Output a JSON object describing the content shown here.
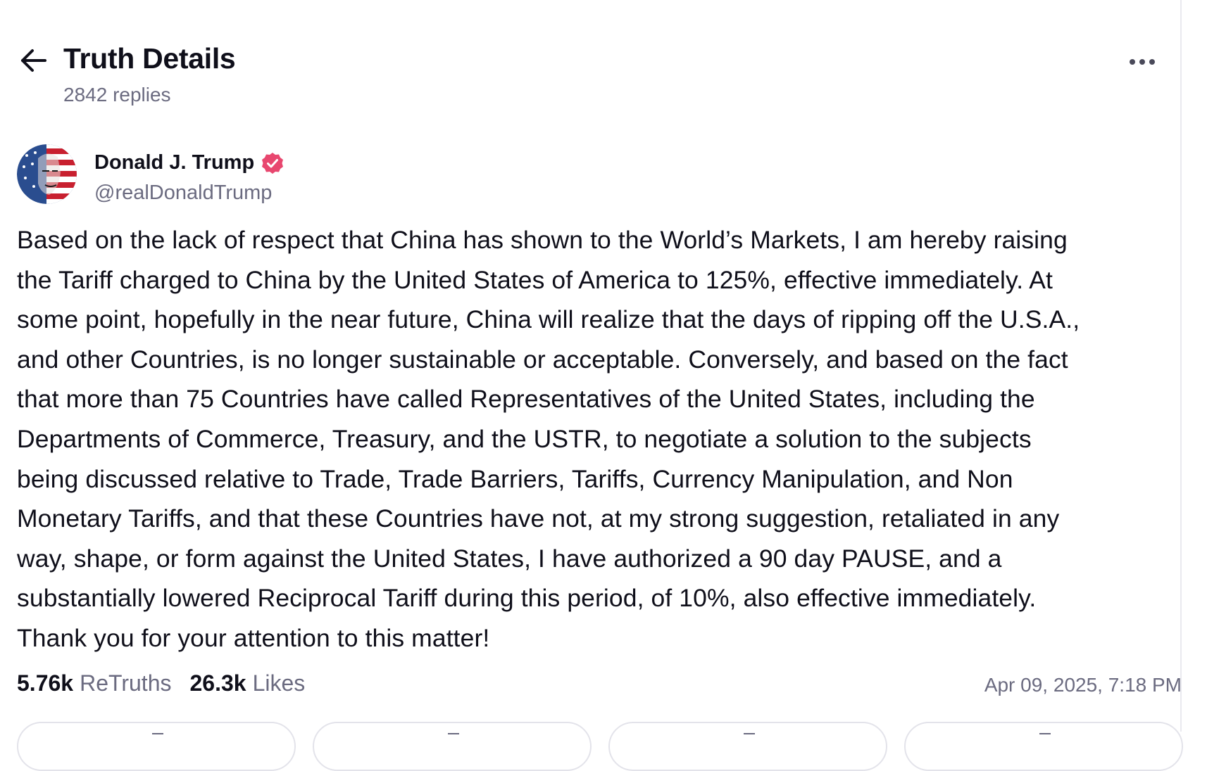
{
  "header": {
    "title": "Truth Details",
    "reply_count": "2842 replies",
    "back_icon": "arrow-left-icon",
    "more_icon": "more-horizontal-icon"
  },
  "post": {
    "author": {
      "name": "Donald J. Trump",
      "handle": "@realDonaldTrump",
      "verified": true,
      "avatar": "avatar-image"
    },
    "body_lines": [
      "Based on the lack of respect that China has shown to the World’s Markets, I am hereby raising",
      "the Tariff charged to China by the United States of America to 125%, effective immediately. At",
      "some point, hopefully in the near future, China will realize that the days of ripping off the U.S.A.,",
      "and other Countries, is no longer sustainable or acceptable. Conversely, and based on the fact",
      "that more than 75 Countries have called Representatives of the United States, including the",
      "Departments of Commerce, Treasury, and the USTR, to negotiate a solution to the subjects",
      "being discussed relative to Trade, Trade Barriers, Tariffs, Currency Manipulation, and Non",
      "Monetary Tariffs, and that these Countries have not, at my strong suggestion, retaliated in any",
      "way, shape, or form against the United States, I have authorized a 90 day PAUSE, and a",
      "substantially lowered Reciprocal Tariff during this period, of 10%, also effective immediately.",
      "Thank you for your attention to this matter!"
    ],
    "stats": {
      "retruths_count": "5.76k",
      "retruths_label": "ReTruths",
      "likes_count": "26.3k",
      "likes_label": "Likes"
    },
    "timestamp": "Apr 09, 2025, 7:18 PM"
  },
  "actions": [
    {
      "name": "reply-button",
      "icon": "reply-icon"
    },
    {
      "name": "retruth-button",
      "icon": "retruth-icon"
    },
    {
      "name": "like-button",
      "icon": "heart-icon"
    },
    {
      "name": "share-button",
      "icon": "share-icon"
    }
  ],
  "colors": {
    "text_primary": "#0f0f1a",
    "text_secondary": "#6b6b80",
    "verified_badge": "#e8476f",
    "divider": "#e9e9ef"
  }
}
